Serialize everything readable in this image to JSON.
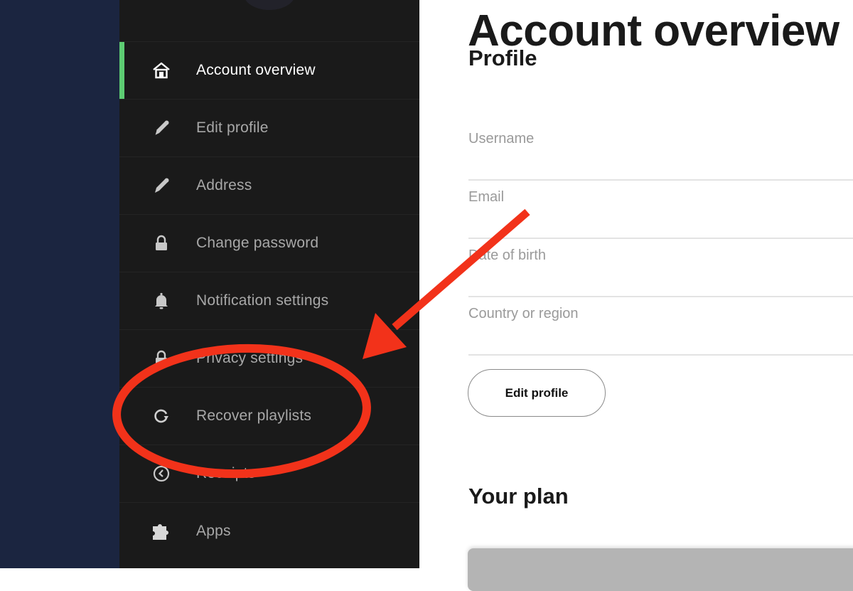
{
  "sidebar": {
    "active_color": "#5dcc73",
    "items": [
      {
        "label": "Account overview",
        "icon": "home-icon",
        "active": true
      },
      {
        "label": "Edit profile",
        "icon": "pencil-icon",
        "active": false
      },
      {
        "label": "Address",
        "icon": "pencil-icon",
        "active": false
      },
      {
        "label": "Change password",
        "icon": "lock-icon",
        "active": false
      },
      {
        "label": "Notification settings",
        "icon": "bell-icon",
        "active": false
      },
      {
        "label": "Privacy settings",
        "icon": "lock-icon",
        "active": false
      },
      {
        "label": "Recover playlists",
        "icon": "refresh-icon",
        "active": false
      },
      {
        "label": "Receipts",
        "icon": "clock-back-icon",
        "active": false
      },
      {
        "label": "Apps",
        "icon": "puzzle-icon",
        "active": false
      }
    ]
  },
  "main": {
    "title": "Account overview",
    "profile": {
      "heading": "Profile",
      "fields": [
        {
          "label": "Username"
        },
        {
          "label": "Email"
        },
        {
          "label": "Date of birth"
        },
        {
          "label": "Country or region"
        }
      ],
      "edit_button": "Edit profile"
    },
    "plan": {
      "heading": "Your plan"
    }
  },
  "annotation": {
    "color": "#f2321a",
    "highlighted_item": "Recover playlists"
  }
}
